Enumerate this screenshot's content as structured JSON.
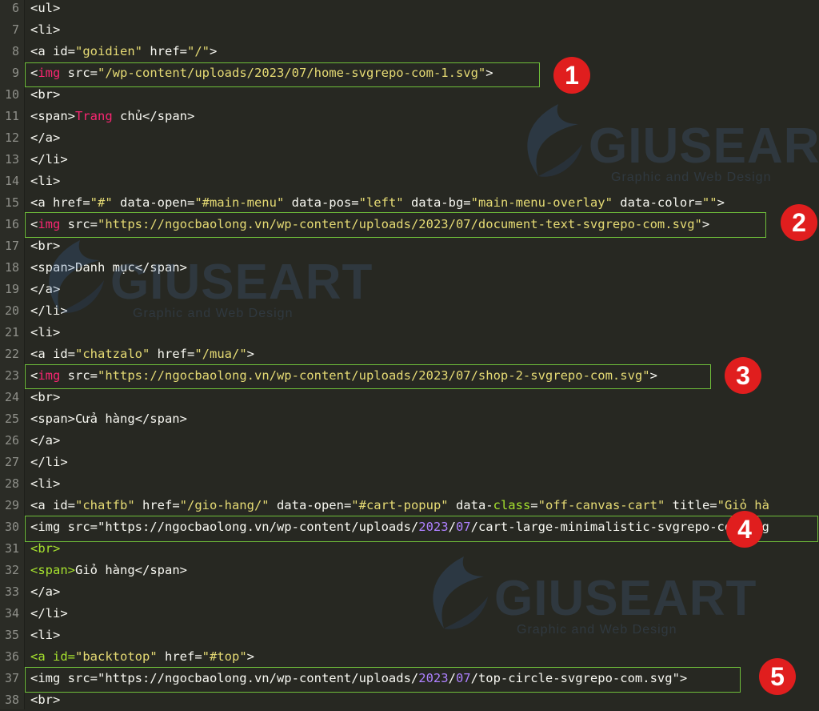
{
  "lines": [
    {
      "n": "6",
      "tokens": [
        [
          "t",
          "<ul>"
        ]
      ]
    },
    {
      "n": "7",
      "tokens": [
        [
          "t",
          "<li>"
        ]
      ]
    },
    {
      "n": "8",
      "tokens": [
        [
          "t",
          "<a id="
        ],
        [
          "s",
          "\"goidien\""
        ],
        [
          "t",
          " href="
        ],
        [
          "s",
          "\"/\""
        ],
        [
          "t",
          ">"
        ]
      ]
    },
    {
      "n": "9",
      "tokens": [
        [
          "t",
          "<"
        ],
        [
          "tr",
          "img"
        ],
        [
          "t",
          " src="
        ],
        [
          "s",
          "\"/wp-content/uploads/2023/07/home-svgrepo-com-1.svg\""
        ],
        [
          "t",
          ">"
        ]
      ]
    },
    {
      "n": "10",
      "tokens": [
        [
          "t",
          "<br>"
        ]
      ]
    },
    {
      "n": "11",
      "tokens": [
        [
          "t",
          "<span>"
        ],
        [
          "tr",
          "Trang"
        ],
        [
          "t",
          " chủ</span>"
        ]
      ]
    },
    {
      "n": "12",
      "tokens": [
        [
          "t",
          "</a>"
        ]
      ]
    },
    {
      "n": "13",
      "tokens": [
        [
          "t",
          "</li>"
        ]
      ]
    },
    {
      "n": "14",
      "tokens": [
        [
          "t",
          "<li>"
        ]
      ]
    },
    {
      "n": "15",
      "tokens": [
        [
          "t",
          "<a href="
        ],
        [
          "s",
          "\"#\""
        ],
        [
          "t",
          " data-open="
        ],
        [
          "s",
          "\"#main-menu\""
        ],
        [
          "t",
          " data-pos="
        ],
        [
          "s",
          "\"left\""
        ],
        [
          "t",
          " data-bg="
        ],
        [
          "s",
          "\"main-menu-overlay\""
        ],
        [
          "t",
          " data-color="
        ],
        [
          "s",
          "\"\""
        ],
        [
          "t",
          ">"
        ]
      ]
    },
    {
      "n": "16",
      "tokens": [
        [
          "t",
          "<"
        ],
        [
          "tr",
          "img"
        ],
        [
          "t",
          " src="
        ],
        [
          "s",
          "\"https://ngocbaolong.vn/wp-content/uploads/2023/07/document-text-svgrepo-com.svg\""
        ],
        [
          "t",
          ">"
        ]
      ]
    },
    {
      "n": "17",
      "tokens": [
        [
          "t",
          "<br>"
        ]
      ]
    },
    {
      "n": "18",
      "tokens": [
        [
          "t",
          "<span>Danh mục</span>"
        ]
      ]
    },
    {
      "n": "19",
      "tokens": [
        [
          "t",
          "</a>"
        ]
      ]
    },
    {
      "n": "20",
      "tokens": [
        [
          "t",
          "</li>"
        ]
      ]
    },
    {
      "n": "21",
      "tokens": [
        [
          "t",
          "<li>"
        ]
      ]
    },
    {
      "n": "22",
      "tokens": [
        [
          "t",
          "<a id="
        ],
        [
          "s",
          "\"chatzalo\""
        ],
        [
          "t",
          " href="
        ],
        [
          "s",
          "\"/mua/\""
        ],
        [
          "t",
          ">"
        ]
      ]
    },
    {
      "n": "23",
      "tokens": [
        [
          "t",
          "<"
        ],
        [
          "tr",
          "img"
        ],
        [
          "t",
          " src="
        ],
        [
          "s",
          "\"https://ngocbaolong.vn/wp-content/uploads/2023/07/shop-2-svgrepo-com.svg\""
        ],
        [
          "t",
          ">"
        ]
      ]
    },
    {
      "n": "24",
      "tokens": [
        [
          "t",
          "<br>"
        ]
      ]
    },
    {
      "n": "25",
      "tokens": [
        [
          "t",
          "<span>Cửa hàng</span>"
        ]
      ]
    },
    {
      "n": "26",
      "tokens": [
        [
          "t",
          "</a>"
        ]
      ]
    },
    {
      "n": "27",
      "tokens": [
        [
          "t",
          "</li>"
        ]
      ]
    },
    {
      "n": "28",
      "tokens": [
        [
          "t",
          "<li>"
        ]
      ]
    },
    {
      "n": "29",
      "tokens": [
        [
          "t",
          "<a id="
        ],
        [
          "s",
          "\"chatfb\""
        ],
        [
          "t",
          " href="
        ],
        [
          "s",
          "\"/gio-hang/\""
        ],
        [
          "t",
          " data-open="
        ],
        [
          "s",
          "\"#cart-popup\""
        ],
        [
          "t",
          " data-"
        ],
        [
          "a",
          "class"
        ],
        [
          "t",
          "="
        ],
        [
          "s",
          "\"off-canvas-cart\""
        ],
        [
          "t",
          " title="
        ],
        [
          "s",
          "\"Giỏ hà"
        ]
      ]
    },
    {
      "n": "30",
      "tokens": [
        [
          "t",
          "<img src=\"https://ngocbaolong.vn/wp-content/uploads/"
        ],
        [
          "p",
          "2023"
        ],
        [
          "t",
          "/"
        ],
        [
          "p",
          "07"
        ],
        [
          "t",
          "/cart-large-minimalistic-svgrepo-com.svg"
        ]
      ]
    },
    {
      "n": "31",
      "tokens": [
        [
          "a",
          "<br>"
        ]
      ]
    },
    {
      "n": "32",
      "tokens": [
        [
          "a",
          "<span>"
        ],
        [
          "t",
          "Giỏ hàng</span>"
        ]
      ]
    },
    {
      "n": "33",
      "tokens": [
        [
          "t",
          "</a>"
        ]
      ]
    },
    {
      "n": "34",
      "tokens": [
        [
          "t",
          "</li>"
        ]
      ]
    },
    {
      "n": "35",
      "tokens": [
        [
          "t",
          "<li>"
        ]
      ]
    },
    {
      "n": "36",
      "tokens": [
        [
          "a",
          "<a id="
        ],
        [
          "s",
          "\"backtotop\""
        ],
        [
          "t",
          " href="
        ],
        [
          "s",
          "\"#top\""
        ],
        [
          "t",
          ">"
        ]
      ]
    },
    {
      "n": "37",
      "tokens": [
        [
          "t",
          "<img src=\"https://ngocbaolong.vn/wp-content/uploads/"
        ],
        [
          "p",
          "2023"
        ],
        [
          "t",
          "/"
        ],
        [
          "p",
          "07"
        ],
        [
          "t",
          "/top-circle-svgrepo-com.svg\">"
        ]
      ]
    },
    {
      "n": "38",
      "tokens": [
        [
          "t",
          "<br>"
        ]
      ]
    }
  ],
  "badges": [
    "1",
    "2",
    "3",
    "4",
    "5"
  ],
  "watermark": {
    "brand": "GIUSEART",
    "tagline": "Graphic and Web Design"
  },
  "colors": {
    "background": "#272822",
    "highlight_box": "#6fbf3a",
    "badge": "#e01e1e",
    "string": "#e6db74",
    "tag": "#f92672",
    "attr": "#a6e22e",
    "number": "#ae81ff"
  }
}
